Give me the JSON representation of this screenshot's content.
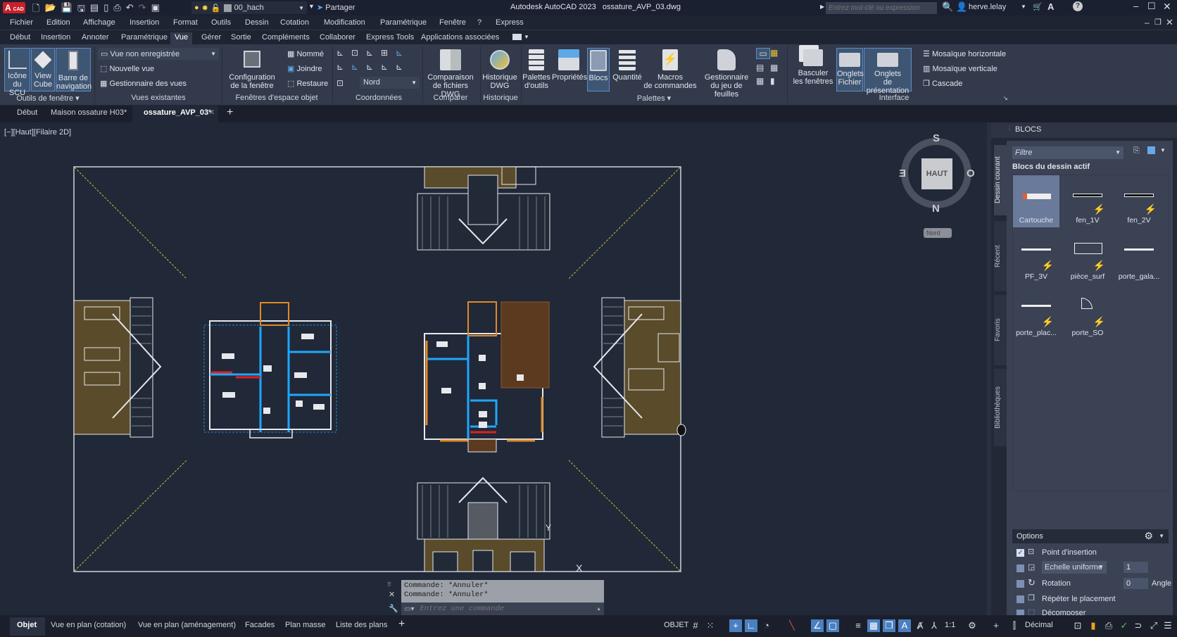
{
  "titlebar": {
    "app_badge": "A",
    "app_badge_sub": "CAD",
    "layer_name": "00_hach",
    "share_label": "Partager",
    "title": "Autodesk AutoCAD 2023",
    "filename": "ossature_AVP_03.dwg",
    "search_placeholder": "Entrez mot-clé ou expression",
    "user": "herve.lelay"
  },
  "menubar": [
    "Fichier",
    "Edition",
    "Affichage",
    "Insertion",
    "Format",
    "Outils",
    "Dessin",
    "Cotation",
    "Modification",
    "Paramétrique",
    "Fenêtre",
    "?",
    "Express"
  ],
  "ribbon_tabs": [
    "Début",
    "Insertion",
    "Annoter",
    "Paramétrique",
    "Vue",
    "Gérer",
    "Sortie",
    "Compléments",
    "Collaborer",
    "Express Tools",
    "Applications associées"
  ],
  "ribbon_active_tab": "Vue",
  "ribbon": {
    "outils_fenetre": {
      "panel_label": "Outils de fenêtre ▾",
      "buttons": [
        {
          "l1": "Icône",
          "l2": "du SCU"
        },
        {
          "l1": "View",
          "l2": "Cube"
        },
        {
          "l1": "Barre de",
          "l2": "navigation"
        }
      ]
    },
    "vues_existantes": {
      "panel_label": "Vues existantes",
      "dropdown_value": "Vue non enregistrée",
      "items": [
        "Nouvelle vue",
        "Gestionnaire des vues"
      ]
    },
    "fenetres_objet": {
      "panel_label": "Fenêtres d'espace objet",
      "config_l1": "Configuration",
      "config_l2": "de la fenêtre",
      "items": [
        "Nommé",
        "Joindre",
        "Restaure"
      ]
    },
    "coordonnees": {
      "panel_label": "Coordonnées",
      "dropdown_value": "Nord"
    },
    "comparer": {
      "panel_label": "Comparer",
      "l1": "Comparaison",
      "l2": "de fichiers DWG"
    },
    "historique": {
      "panel_label": "Historique",
      "l1": "Historique",
      "l2": "DWG"
    },
    "palettes": {
      "panel_label": "Palettes ▾",
      "buttons": [
        {
          "l1": "Palettes",
          "l2": "d'outils"
        },
        {
          "l1": "Propriétés",
          "l2": ""
        },
        {
          "l1": "Blocs",
          "l2": ""
        },
        {
          "l1": "Quantité",
          "l2": ""
        },
        {
          "l1": "Macros",
          "l2": "de commandes"
        },
        {
          "l1": "Gestionnaire",
          "l2": "du jeu de feuilles"
        }
      ]
    },
    "interface": {
      "panel_label": "Interface",
      "buttons": [
        {
          "l1": "Basculer",
          "l2": "les fenêtres"
        },
        {
          "l1": "Onglets",
          "l2": "Fichier"
        },
        {
          "l1": "Onglets",
          "l2": "de présentation"
        }
      ],
      "items": [
        "Mosaïque horizontale",
        "Mosaïque verticale",
        "Cascade"
      ]
    }
  },
  "file_tabs": [
    "Début",
    "Maison ossature H03*",
    "ossature_AVP_03*"
  ],
  "viewport_label": "[−][Haut][Filaire 2D]",
  "viewcube": {
    "top": "S",
    "right": "O",
    "bottom": "N",
    "left": "E",
    "face": "HAUT",
    "ucs": "Nord"
  },
  "command": {
    "history": [
      "Commande: *Annuler*",
      "Commande: *Annuler*"
    ],
    "placeholder": "Entrez une commande"
  },
  "palette": {
    "title": "BLOCS",
    "filter_placeholder": "Filtre",
    "section": "Blocs du dessin actif",
    "side_tabs": [
      "Dessin courant",
      "Récent",
      "Favoris",
      "Bibliothèques"
    ],
    "blocks": [
      {
        "name": "Cartouche",
        "dynamic": false,
        "selected": true
      },
      {
        "name": "fen_1V",
        "dynamic": true
      },
      {
        "name": "fen_2V",
        "dynamic": true
      },
      {
        "name": "PF_3V",
        "dynamic": true
      },
      {
        "name": "pièce_surf",
        "dynamic": true
      },
      {
        "name": "porte_gala...",
        "dynamic": false
      },
      {
        "name": "porte_plac...",
        "dynamic": true
      },
      {
        "name": "porte_SO",
        "dynamic": true
      }
    ],
    "options": {
      "title": "Options",
      "insertion_point": {
        "label": "Point d'insertion",
        "checked": true
      },
      "scale": {
        "label": "Echelle uniforme",
        "value": "1",
        "checked": false
      },
      "rotation": {
        "label": "Rotation",
        "value": "0",
        "unit": "Angle",
        "checked": false
      },
      "repeat": {
        "label": "Répéter le placement",
        "checked": false
      },
      "explode": {
        "label": "Décomposer",
        "checked": false
      }
    }
  },
  "layout_tabs": [
    "Objet",
    "Vue en plan (cotation)",
    "Vue en plan (aménagement)",
    "Facades",
    "Plan masse",
    "Liste des plans"
  ],
  "statusbar": {
    "mode": "OBJET",
    "scale": "1:1",
    "units": "Décimal"
  },
  "colors": {
    "accent": "#4a7fc0",
    "wall_blue": "#1ea7ff",
    "wall_orange": "#e08a25",
    "wall_red": "#e02020",
    "guide_yellow": "#c9c23a"
  }
}
